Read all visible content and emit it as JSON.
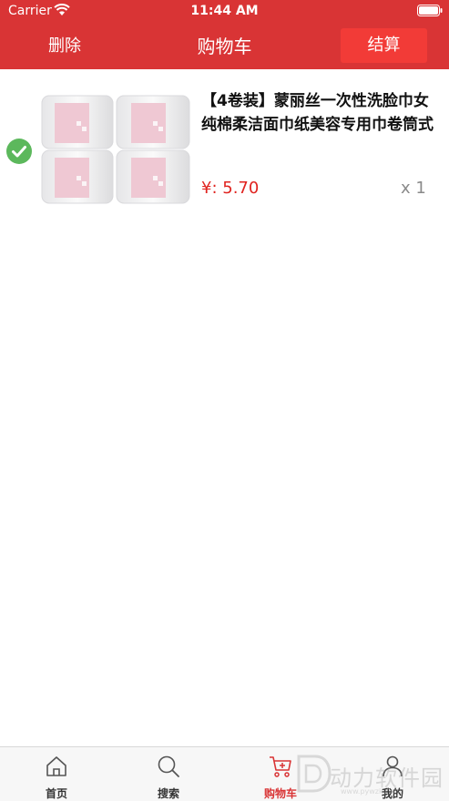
{
  "status_bar": {
    "carrier": "Carrier",
    "time": "11:44 AM"
  },
  "nav": {
    "delete_label": "删除",
    "title": "购物车",
    "checkout_label": "结算"
  },
  "cart": {
    "items": [
      {
        "title": "【4卷装】蒙丽丝一次性洗脸巾女纯棉柔洁面巾纸美容专用巾卷筒式",
        "price": "¥: 5.70",
        "quantity": "x 1",
        "selected": true
      }
    ]
  },
  "tabs": [
    {
      "label": "首页",
      "icon": "home-icon",
      "active": false
    },
    {
      "label": "搜索",
      "icon": "search-icon",
      "active": false
    },
    {
      "label": "购物车",
      "icon": "cart-icon",
      "active": true
    },
    {
      "label": "我的",
      "icon": "user-icon",
      "active": false
    }
  ],
  "watermark": {
    "text": "动力软件园",
    "url": "www.pywzky.com"
  },
  "colors": {
    "header": "#d93435",
    "checkout_button": "#f23b37",
    "price": "#e0231f",
    "check": "#5cb85c"
  }
}
